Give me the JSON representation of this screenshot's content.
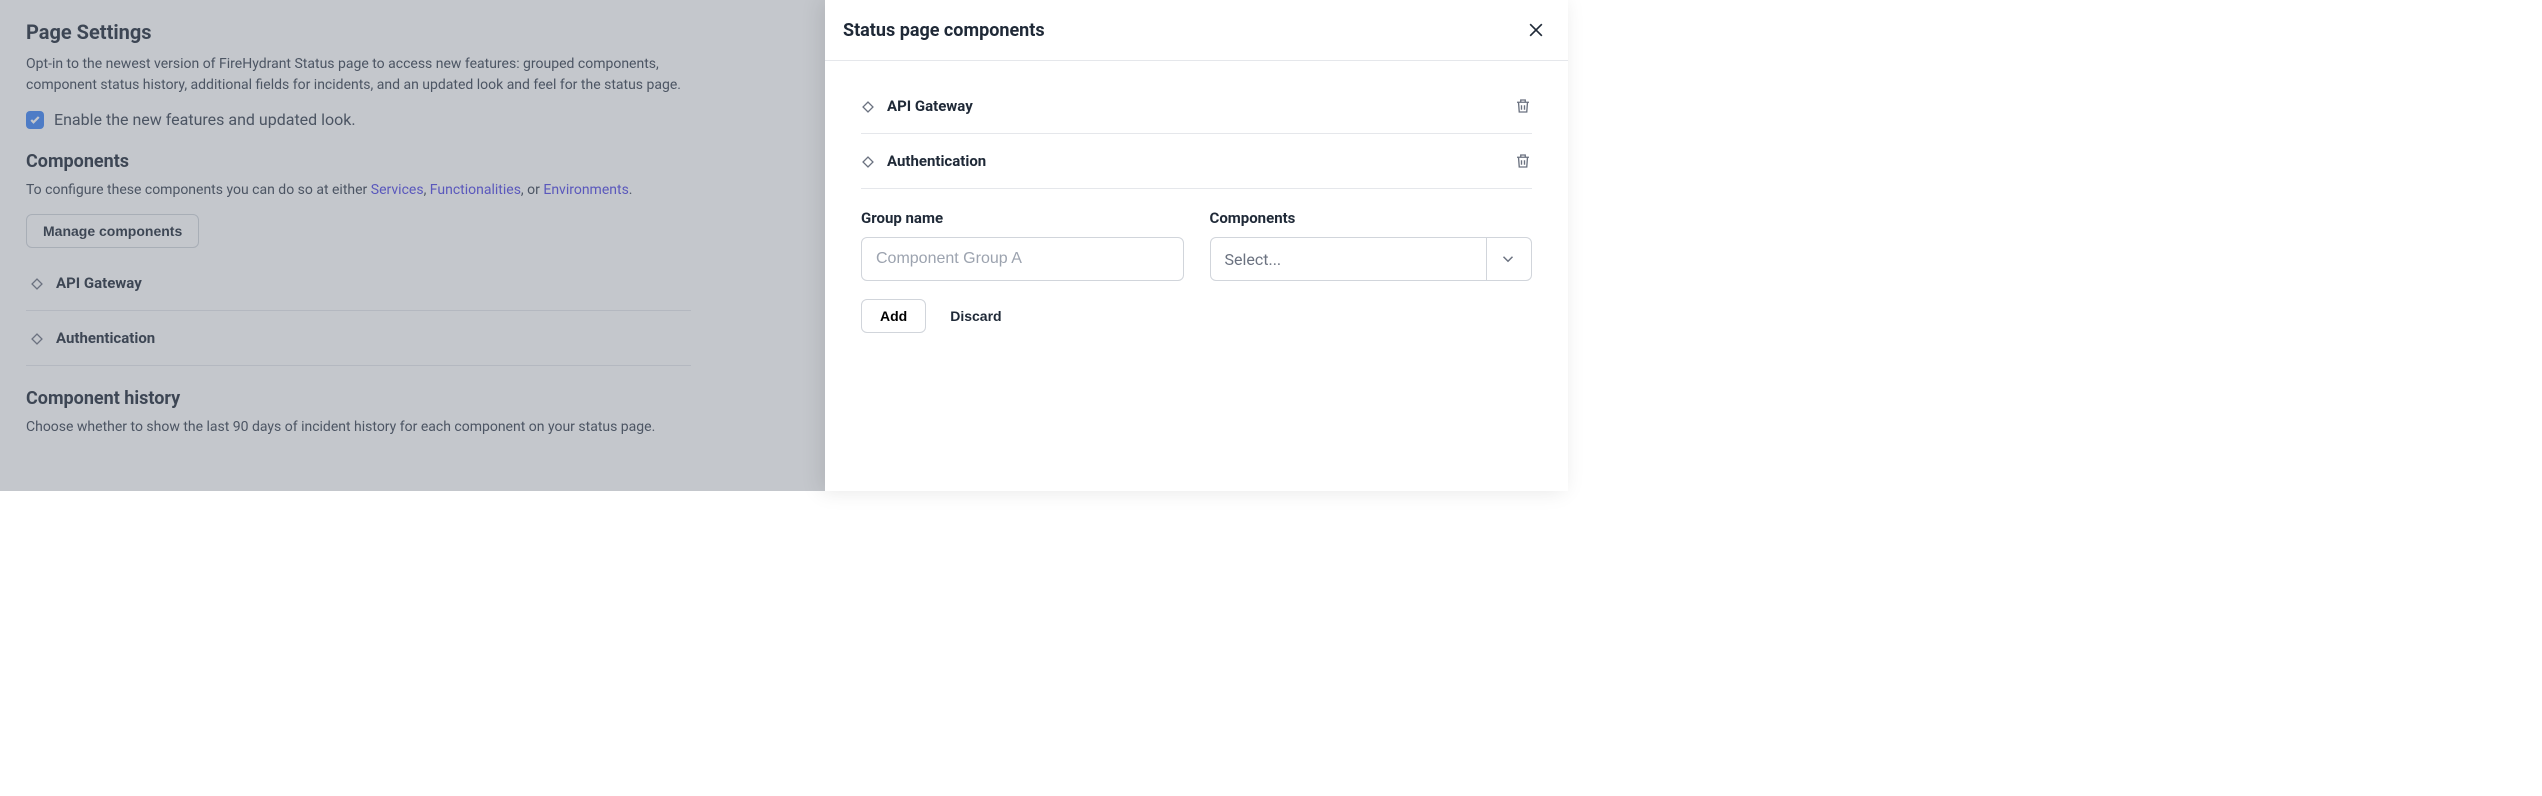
{
  "page": {
    "title": "Page Settings",
    "intro": "Opt-in to the newest version of FireHydrant Status page to access new features: grouped components, component status history, additional fields for incidents, and an updated look and feel for the status page.",
    "enable_label": "Enable the new features and updated look.",
    "enable_checked": true
  },
  "components_section": {
    "heading": "Components",
    "desc_prefix": "To configure these components you can do so at either ",
    "link_services": "Services",
    "link_functionalities": "Functionalities",
    "link_environments": "Environments",
    "sep1": ", ",
    "sep2": ", or ",
    "sep3": ".",
    "manage_button": "Manage components",
    "items": [
      {
        "label": "API Gateway"
      },
      {
        "label": "Authentication"
      }
    ]
  },
  "history_section": {
    "heading": "Component history",
    "desc": "Choose whether to show the last 90 days of incident history for each component on your status page."
  },
  "drawer": {
    "title": "Status page components",
    "items": [
      {
        "label": "API Gateway"
      },
      {
        "label": "Authentication"
      }
    ],
    "form": {
      "group_name_label": "Group name",
      "group_name_placeholder": "Component Group A",
      "components_label": "Components",
      "components_placeholder": "Select..."
    },
    "actions": {
      "add": "Add",
      "discard": "Discard"
    }
  }
}
